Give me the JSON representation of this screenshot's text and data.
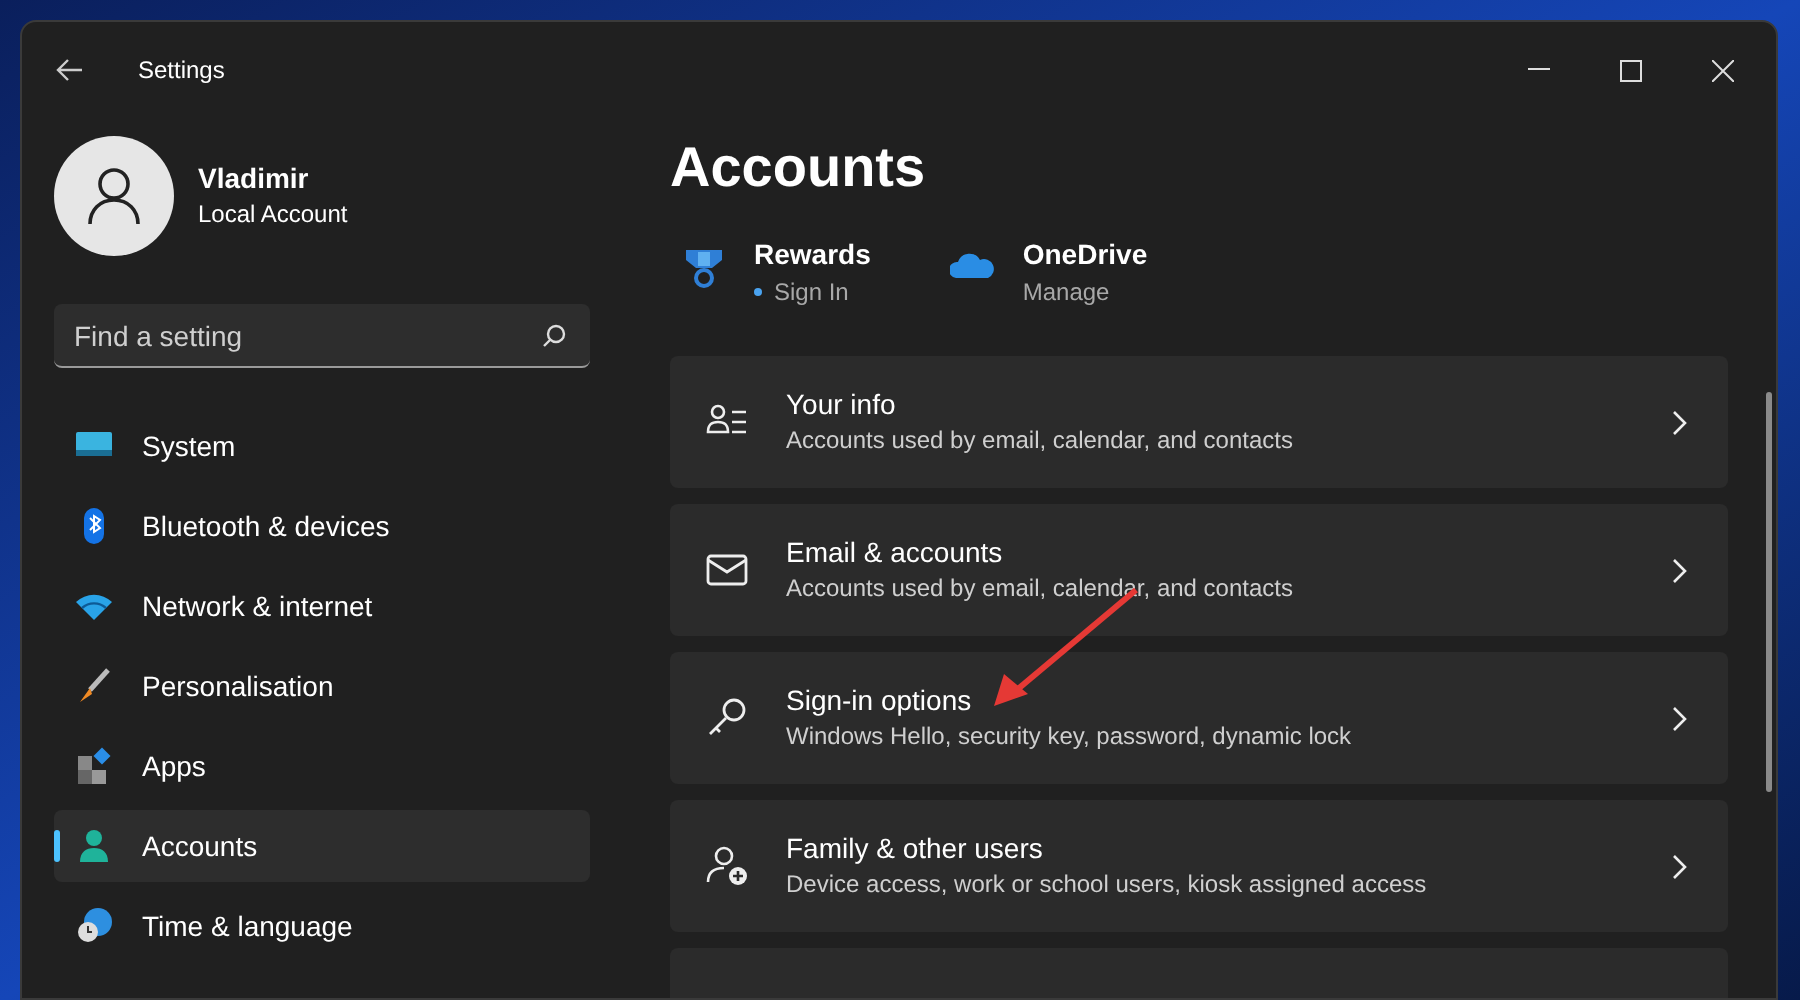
{
  "window": {
    "title": "Settings"
  },
  "user": {
    "name": "Vladimir",
    "account_type": "Local Account"
  },
  "search": {
    "placeholder": "Find a setting"
  },
  "sidebar": {
    "items": [
      {
        "label": "System",
        "selected": false
      },
      {
        "label": "Bluetooth & devices",
        "selected": false
      },
      {
        "label": "Network & internet",
        "selected": false
      },
      {
        "label": "Personalisation",
        "selected": false
      },
      {
        "label": "Apps",
        "selected": false
      },
      {
        "label": "Accounts",
        "selected": true
      },
      {
        "label": "Time & language",
        "selected": false
      }
    ]
  },
  "page": {
    "title": "Accounts",
    "services": [
      {
        "name": "Rewards",
        "status": "Sign In",
        "dot": true
      },
      {
        "name": "OneDrive",
        "status": "Manage",
        "dot": false
      }
    ],
    "cards": [
      {
        "title": "Your info",
        "subtitle": "Accounts used by email, calendar, and contacts"
      },
      {
        "title": "Email & accounts",
        "subtitle": "Accounts used by email, calendar, and contacts"
      },
      {
        "title": "Sign-in options",
        "subtitle": "Windows Hello, security key, password, dynamic lock"
      },
      {
        "title": "Family & other users",
        "subtitle": "Device access, work or school users, kiosk assigned access"
      }
    ]
  }
}
